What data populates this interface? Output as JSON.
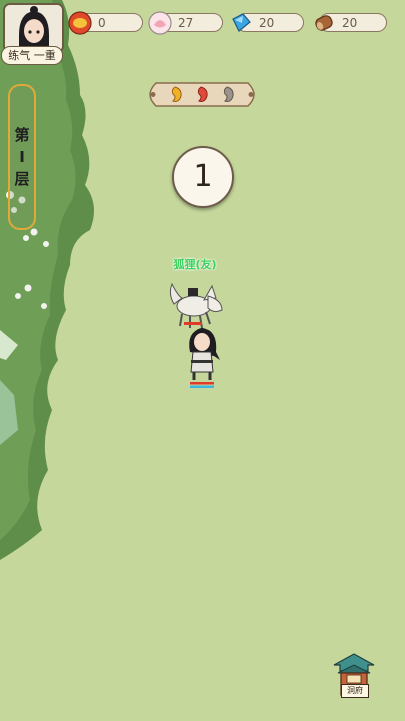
{
  "player": {
    "rank": "练气 一重",
    "avatar_icon": "cultivator-portrait-icon"
  },
  "resources": [
    {
      "icon": "gold-ingot-icon",
      "value": "0"
    },
    {
      "icon": "peach-icon",
      "value": "27"
    },
    {
      "icon": "spirit-crystal-icon",
      "value": "20"
    },
    {
      "icon": "wood-log-icon",
      "value": "20"
    }
  ],
  "floor": {
    "chars": [
      "第",
      "Ⅰ",
      "层"
    ]
  },
  "drops": [
    "orange-flame-icon",
    "red-flame-icon",
    "grey-flame-icon"
  ],
  "counter": "1",
  "companion": {
    "label": "狐狸(友)"
  },
  "cave": {
    "label": "洞府"
  },
  "colors": {
    "bg": "#c5d79b",
    "grass": "#5f8d4a",
    "accent": "#e1a93a",
    "friend": "#3ad25b"
  }
}
